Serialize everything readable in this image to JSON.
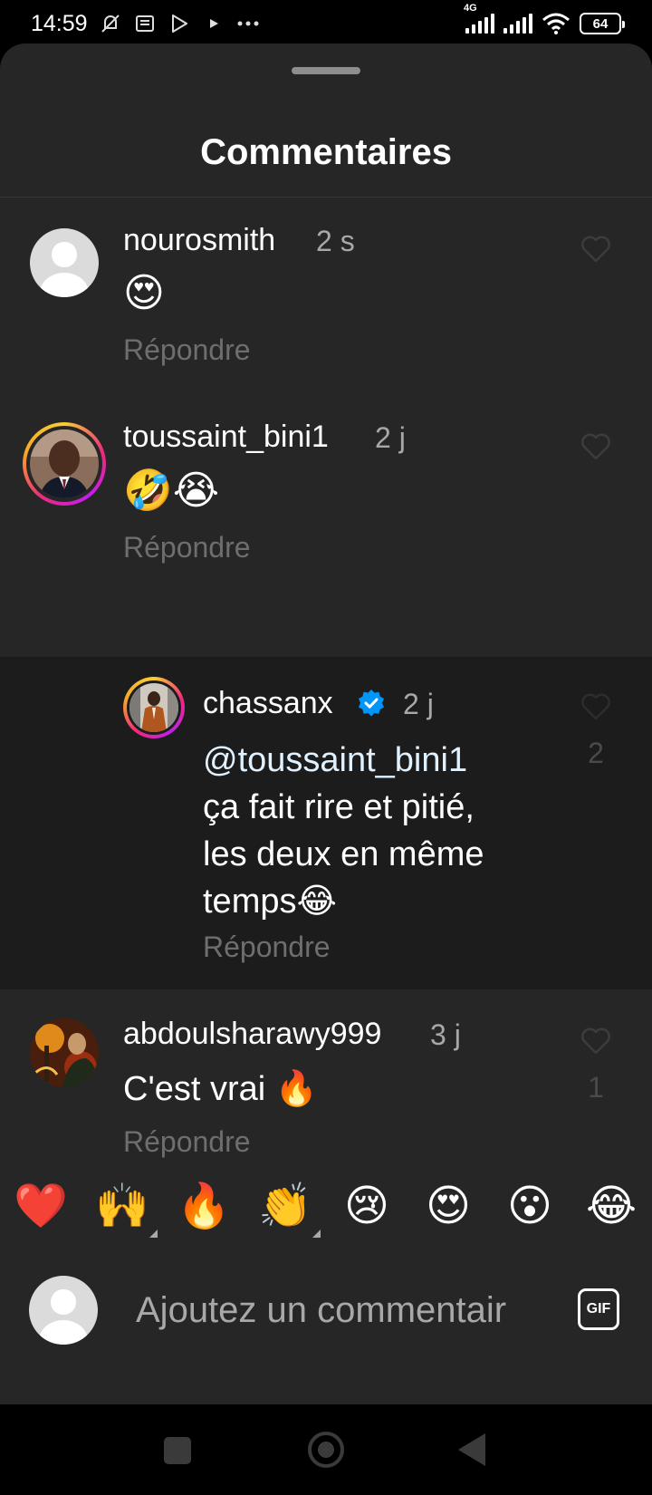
{
  "status_bar": {
    "time": "14:59",
    "icons_left": [
      "mute-icon",
      "news-icon",
      "play-store-icon",
      "play-icon",
      "more-icon"
    ],
    "network_type": "4G",
    "battery": "64"
  },
  "sheet": {
    "title": "Commentaires"
  },
  "comments": [
    {
      "username": "nourosmith",
      "time": "2 s",
      "text": "😍",
      "reply_label": "Répondre",
      "avatar": "default",
      "like_count": ""
    },
    {
      "username": "toussaint_bini1",
      "time": "2 j",
      "text": "🤣😭",
      "reply_label": "Répondre",
      "avatar": "photo",
      "like_count": ""
    },
    {
      "username": "chassanx",
      "verified": true,
      "time": "2 j",
      "mention": "@toussaint_bini1",
      "text_line1": "ça fait rire et pitié,",
      "text_line2": "les deux en même",
      "text_line3": "temps😂",
      "reply_label": "Répondre",
      "avatar": "photo",
      "like_count": "2"
    },
    {
      "username": "abdoulsharawy999",
      "time": "3 j",
      "text": "C'est vrai 🔥",
      "reply_label": "Répondre",
      "avatar": "photo",
      "like_count": "1"
    }
  ],
  "quick_reactions": [
    "❤️",
    "🙌",
    "🔥",
    "👏",
    "😢",
    "😍",
    "😮",
    "😂"
  ],
  "input": {
    "placeholder": "Ajoutez un commentair",
    "gif_label": "GIF"
  },
  "colors": {
    "sheet_bg": "#262626",
    "highlight_bg": "#1c1c1c",
    "verified": "#0095f6",
    "secondary_text": "#a8a8a8"
  }
}
